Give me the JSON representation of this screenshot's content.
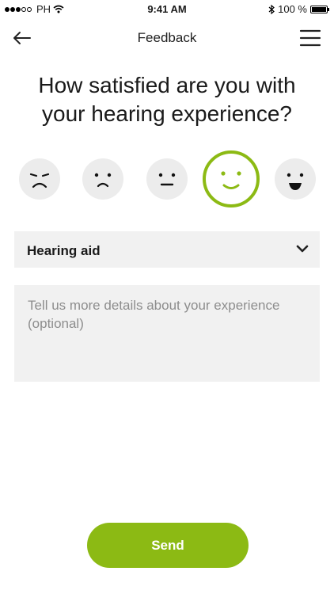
{
  "status_bar": {
    "carrier": "PH",
    "time": "9:41 AM",
    "battery_label": "100 %",
    "battery_level": 1.0,
    "signal_bars": 3,
    "signal_total": 5
  },
  "nav": {
    "title": "Feedback",
    "back_icon": "arrow-left-icon",
    "menu_icon": "hamburger-menu-icon"
  },
  "question": {
    "line1": "How satisfied are you with",
    "line2": "your hearing experience?"
  },
  "ratings": {
    "options": [
      "very-dissatisfied-face-icon",
      "dissatisfied-face-icon",
      "neutral-face-icon",
      "satisfied-face-icon",
      "very-satisfied-face-icon"
    ],
    "selected_index": 3
  },
  "topic_select": {
    "selected": "Hearing aid",
    "icon": "chevron-down-icon"
  },
  "details": {
    "placeholder": "Tell us more details about your experience (optional)",
    "value": ""
  },
  "send_button": {
    "label": "Send"
  },
  "colors": {
    "accent": "#8cba14",
    "face_bg": "#ececec",
    "field_bg": "#f1f1f1"
  }
}
